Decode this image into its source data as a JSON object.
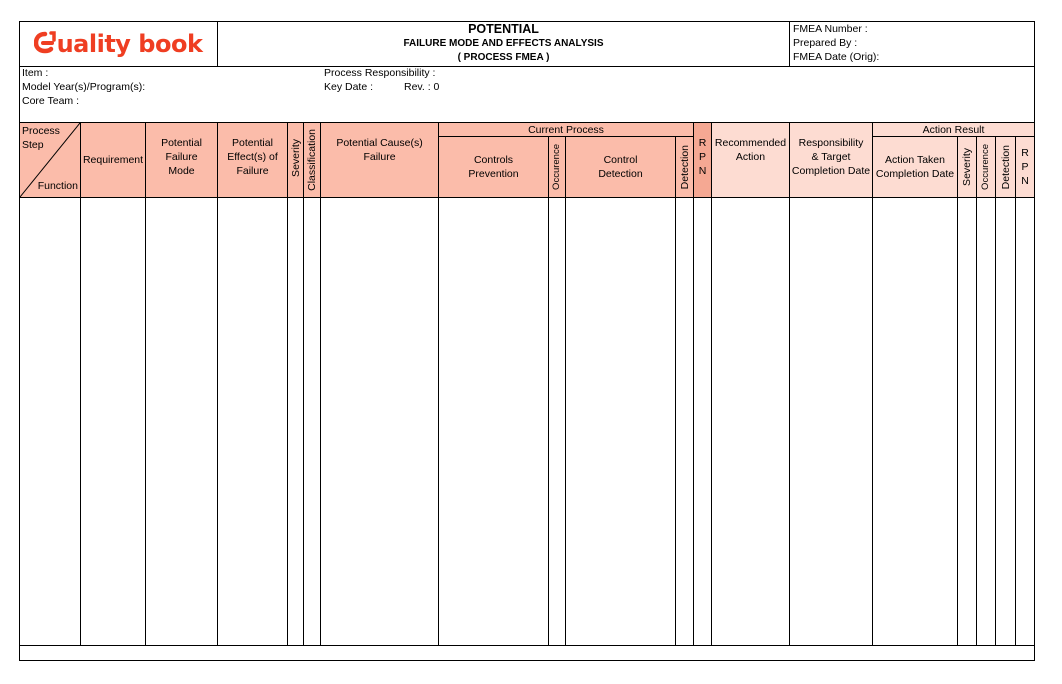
{
  "logo": {
    "text": "uality book",
    "mark": "q-swirl",
    "color": "#ef3e22"
  },
  "title": {
    "line1": "POTENTIAL",
    "line2": "FAILURE MODE AND EFFECTS ANALYSIS",
    "line3": "( PROCESS FMEA )"
  },
  "meta_right": {
    "fmea_number": "FMEA Number :",
    "prepared_by": "Prepared By :",
    "fmea_date": "FMEA Date (Orig):"
  },
  "info_left": {
    "item": "Item :",
    "model_year": "Model Year(s)/Program(s):",
    "core_team": "Core Team :"
  },
  "info_mid": {
    "process_responsibility": "Process Responsibility :",
    "key_date": "Key Date :",
    "rev": "Rev. : 0"
  },
  "colors": {
    "header_fill": "#fbbcaa",
    "header_fill_light": "#fddcd2",
    "rpn_fill": "#f5a893",
    "border": "#000000"
  },
  "columns": {
    "process_step": {
      "top": "Process Step",
      "bottom": "Function"
    },
    "requirement": "Requirement",
    "potential_failure_mode": [
      "Potential",
      "Failure",
      "Mode"
    ],
    "potential_effects": [
      "Potential",
      "Effect(s) of",
      "Failure"
    ],
    "severity": "Severity",
    "classification": "Classification",
    "potential_causes": [
      "Potential Cause(s)",
      "Failure"
    ],
    "current_process": "Current Process",
    "controls_prevention": [
      "Controls",
      "Prevention"
    ],
    "occurrence": "Occurence",
    "control_detection": [
      "Control",
      "Detection"
    ],
    "detection": "Detection",
    "rpn": [
      "R",
      "P",
      "N"
    ],
    "recommended_action": [
      "Recommended",
      "Action"
    ],
    "responsibility": [
      "Responsibility",
      "& Target",
      "Completion Date"
    ],
    "action_result": "Action Result",
    "action_taken": [
      "Action Taken",
      "Completion Date"
    ],
    "ar_severity": "Severity",
    "ar_occurrence": "Occurence",
    "ar_detection": "Detection",
    "ar_rpn": [
      "R",
      "P",
      "N"
    ]
  }
}
